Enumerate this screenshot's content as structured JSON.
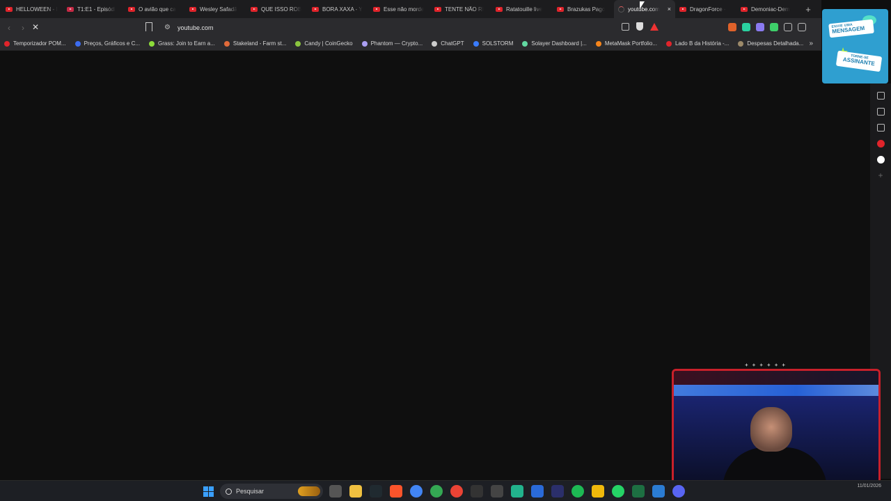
{
  "tabs": [
    {
      "title": "HELLOWEEN - I"
    },
    {
      "title": "T1:E1 - Episódi"
    },
    {
      "title": "O avião que ca"
    },
    {
      "title": "Wesley Safadã"
    },
    {
      "title": "QUE ISSO ROB"
    },
    {
      "title": "BORA XAXA - Y"
    },
    {
      "title": "Esse não morde"
    },
    {
      "title": "TENTE NÃO RI"
    },
    {
      "title": "Ratatouille live"
    },
    {
      "title": "Brazukas Pago"
    },
    {
      "title": "youtube.com",
      "active": true
    },
    {
      "title": "DragonForce -"
    },
    {
      "title": "Demoniac-Dem"
    }
  ],
  "toolbar": {
    "url": "youtube.com",
    "new_tab": "+",
    "close_tab": "×"
  },
  "bookmarks": [
    {
      "label": "Temporizador POM...",
      "color": "#e0242b"
    },
    {
      "label": "Preços, Gráficos e C...",
      "color": "#3c6cf0"
    },
    {
      "label": "Grass: Join to Earn a...",
      "color": "#8ddc3a"
    },
    {
      "label": "Stakeland - Farm st...",
      "color": "#e06a3a"
    },
    {
      "label": "Candy | CoinGecko",
      "color": "#8bc53f"
    },
    {
      "label": "Phantom — Crypto...",
      "color": "#ab9ff2"
    },
    {
      "label": "ChatGPT",
      "color": "#cccccc"
    },
    {
      "label": "SOLSTORM",
      "color": "#3a7cff"
    },
    {
      "label": "Solayer Dashboard |...",
      "color": "#62d9a2"
    },
    {
      "label": "MetaMask Portfolio...",
      "color": "#f6851b"
    },
    {
      "label": "Lado B da História -...",
      "color": "#e0242b"
    },
    {
      "label": "Despesas Detalhada...",
      "color": "#9c8a6a"
    }
  ],
  "promo": {
    "line1_small": "ENVIE UMA",
    "line1_big": "MENSAGEM",
    "line2_small": "TORNE-SE",
    "line2_big": "ASSINANTE"
  },
  "taskbar": {
    "search_placeholder": "Pesquisar",
    "date": "11/01/2026"
  },
  "colors": {
    "accent": "#e0242b",
    "background": "#0f0f0f",
    "promo": "#2f9fd0"
  }
}
